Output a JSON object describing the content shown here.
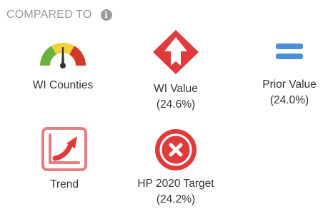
{
  "header": {
    "title": "COMPARED TO",
    "info_icon": "info-icon"
  },
  "items": [
    {
      "label": "WI Counties",
      "value": "",
      "icon": "gauge-icon"
    },
    {
      "label": "WI Value",
      "value": "(24.6%)",
      "icon": "arrow-up-diamond-icon",
      "status_color": "#e03a3a"
    },
    {
      "label": "Prior Value",
      "value": "(24.0%)",
      "icon": "equals-icon",
      "status_color": "#4a90d9"
    },
    {
      "label": "Trend",
      "value": "",
      "icon": "trend-up-icon",
      "status_color": "#e05a5a"
    },
    {
      "label": "HP 2020 Target",
      "value": "(24.2%)",
      "icon": "x-circle-icon",
      "status_color": "#e03a3a"
    }
  ],
  "colors": {
    "red": "#e03a3a",
    "blue": "#4a90d9",
    "gauge_green": "#6ab23c",
    "gauge_yellow": "#f2d23a",
    "gauge_red": "#d23a2a"
  }
}
